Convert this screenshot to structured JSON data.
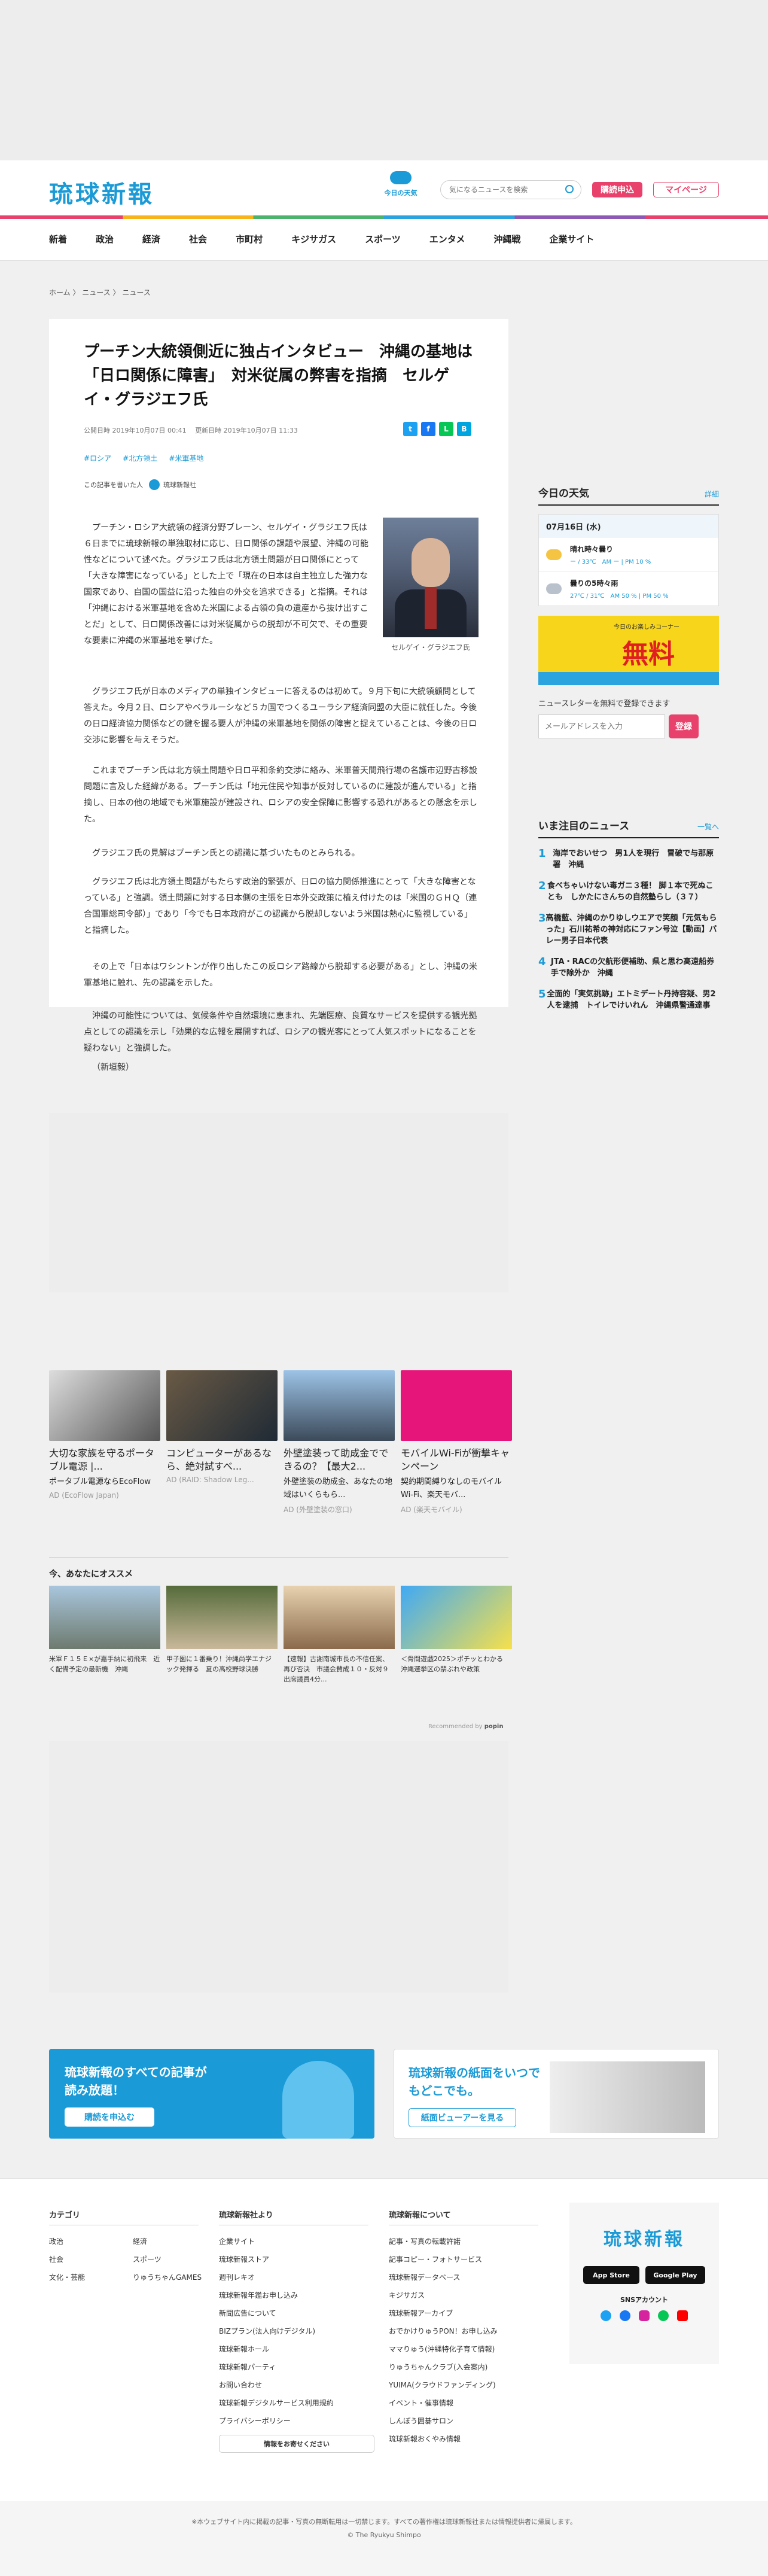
{
  "header": {
    "logo": "琉球新報",
    "weather_label": "今日の天気",
    "search_placeholder": "気になるニュースを検索",
    "subscribe": "購読申込",
    "mypage": "マイページ"
  },
  "nav": {
    "items": [
      "新着",
      "政治",
      "経済",
      "社会",
      "市町村",
      "キジサガス",
      "スポーツ",
      "エンタメ",
      "沖縄戦",
      "企業サイト"
    ]
  },
  "breadcrumb": [
    "ホーム",
    "ニュース",
    "ニュース"
  ],
  "article": {
    "title": "プーチン大統領側近に独占インタビュー　沖縄の基地は「日ロ関係に障害」　対米従属の弊害を指摘　セルゲイ・グラジエフ氏",
    "published": "公開日時 2019年10月07日 00:41",
    "updated": "更新日時 2019年10月07日 11:33",
    "tags": [
      "#ロシア",
      "#北方領土",
      "#米軍基地"
    ],
    "author_label": "この記事を書いた人",
    "author": "琉球新報社",
    "photo_caption": "セルゲイ・グラジエフ氏",
    "paragraphs": [
      "プーチン・ロシア大統領の経済分野ブレーン、セルゲイ・グラジエフ氏は６日までに琉球新報の単独取材に応じ、日ロ関係の課題や展望、沖縄の可能性などについて述べた。グラジエフ氏は北方領土問題が日ロ関係にとって「大きな障害になっている」とした上で「現在の日本は自主独立した強力な国家であり、自国の国益に沿った独自の外交を追求できる」と指摘。それは「沖縄における米軍基地を含めた米国による占領の負の遺産から抜け出すことだ」として、日ロ関係改善には対米従属からの脱却が不可欠で、その重要な要素に沖縄の米軍基地を挙げた。",
      "グラジエフ氏が日本のメディアの単独インタビューに答えるのは初めて。９月下旬に大統領顧問として答えた。今月２日、ロシアやベラルーシなど５カ国でつくるユーラシア経済同盟の大臣に就任した。今後の日ロ経済協力関係などの鍵を握る要人が沖縄の米軍基地を関係の障害と捉えていることは、今後の日ロ交渉に影響を与えそうだ。",
      "これまでプーチン氏は北方領土問題や日ロ平和条約交渉に絡み、米軍普天間飛行場の名護市辺野古移設問題に言及した経緯がある。プーチン氏は「地元住民や知事が反対しているのに建設が進んでいる」と指摘し、日本の他の地域でも米軍施設が建設され、ロシアの安全保障に影響する恐れがあるとの懸念を示した。",
      "グラジエフ氏の見解はプーチン氏との認識に基づいたものとみられる。",
      "グラジエフ氏は北方領土問題がもたらす政治的緊張が、日ロの協力関係推進にとって「大きな障害となっている」と強調。領土問題に対する日本側の主張を日本外交政策に植え付けたのは「米国のＧＨＱ（連合国軍総司令部）」であり「今でも日本政府がこの認識から脱却しないよう米国は熱心に監視している」と指摘した。",
      "その上で「日本はワシントンが作り出したこの反ロシア路線から脱却する必要がある」とし、沖縄の米軍基地に触れ、先の認識を示した。",
      "沖縄の可能性については、気候条件や自然環境に恵まれ、先端医療、良質なサービスを提供する観光拠点としての認識を示し「効果的な広報を展開すれば、ロシアの観光客にとって人気スポットになることを疑わない」と強調した。",
      "（新垣毅）"
    ]
  },
  "sidebar": {
    "weather_title": "今日の天気",
    "weather_detail": "詳細",
    "weather_date": "07月16日 (水)",
    "weather_today": "晴れ時々曇り",
    "weather_today_temp": "ー / 33℃　AM ー | PM 10 %",
    "weather_tomorrow": "曇りの5時々雨",
    "weather_tomorrow_temp": "27℃ / 31℃　AM 50 % | PM 50 %",
    "ad_text": "無料",
    "ad_sub": "今日のお楽しみコーナー",
    "newsletter": "ニュースレターを無料で登録できます",
    "newsletter_placeholder": "メールアドレスを入力",
    "newsletter_button": "登録",
    "ranking_title": "いま注目のニュース",
    "ranking_more": "一覧へ",
    "ranking": [
      {
        "n": "1",
        "t": "海岸でおいせつ　男1人を現行　冒破で与那原署　沖縄"
      },
      {
        "n": "2",
        "t": "食べちゃいけない毒ガニ３種！ 脚１本で死ぬことも　しかたにさんちの自然塾らし（３７）"
      },
      {
        "n": "3",
        "t": "高橋藍、沖縄のかりゆしウエアで笑顔「元気もらった」石川祐希の神対応にファン号泣【動画】バレー男子日本代表"
      },
      {
        "n": "4",
        "t": "JTA・RACの欠航形便補助、県と思わ高遠船券手で除外か　沖縄"
      },
      {
        "n": "5",
        "t": "全面的「実気挑跡」エトミデート丹持容疑、男2人を逮捕　トイレでけいれん　沖縄県警通達事"
      }
    ]
  },
  "ads": [
    {
      "t": "大切な家族を守るポータブル電源 |...",
      "s": "ポータブル電源ならEcoFlow",
      "a": "AD (EcoFlow Japan)"
    },
    {
      "t": "コンピューターがあるなら、絶対試すべ...",
      "s": "",
      "a": "AD (RAID: Shadow Leg..."
    },
    {
      "t": "外壁塗装って助成金でできるの？【最大2...",
      "s": "外壁塗装の助成金、あなたの地域はいくらもら...",
      "a": "AD (外壁塗装の窓口)"
    },
    {
      "t": "モバイルWi-Fiが衝撃キャンペーン",
      "s": "契約期間縛りなしのモバイルWi-Fi、楽天モバ...",
      "a": "AD (楽天モバイル)"
    }
  ],
  "recommend": {
    "title": "今、あなたにオススメ",
    "footer": "Recommended by",
    "items": [
      "米軍Ｆ１５Ｅ×が嘉手納に初飛来　近く配備予定の最新機　沖縄",
      "甲子園に１番乗り！沖縄尚学エナジック発揮る　夏の高校野球決勝",
      "【速報】古謝南城市長の不信任案、再び否決　市議会賛成１０・反対９　出席議員4分...",
      "＜骨間遊戯2025＞ポチッとわかる　沖縄選挙区の禁ぶれや政策"
    ]
  },
  "banners": {
    "left_title": "琉球新報のすべての記事が読み放題！",
    "left_button": "購読を申込む",
    "right_title": "琉球新報の紙面をいつでもどこでも。",
    "right_button": "紙面ビューアーを見る"
  },
  "footer": {
    "cat_title": "カテゴリ",
    "cats": [
      "政治",
      "経済",
      "社会",
      "スポーツ",
      "文化・芸能",
      "りゅうちゃんGAMES"
    ],
    "from_title": "琉球新報社より",
    "from": [
      "企業サイト",
      "琉球新報ストア",
      "週刊レキオ",
      "琉球新報年鑑お申し込み",
      "新聞広告について",
      "BIZプラン(法人向けデジタル)",
      "琉球新報ホール",
      "琉球新報パーティ",
      "お問い合わせ",
      "琉球新報デジタルサービス利用規約",
      "プライバシーポリシー"
    ],
    "about_title": "琉球新報について",
    "about": [
      "記事・写真の転載許諾",
      "記事コピー・フォトサービス",
      "琉球新報データベース",
      "キジサガス",
      "琉球新報アーカイブ",
      "おでかけりゅうPON！お申し込み",
      "ママりゅう(沖縄特化子育て情報)",
      "りゅうちゃんクラブ(入会案内)",
      "YUIMA(クラウドファンディング)",
      "イベント・催事情報",
      "しんぽう囲碁サロン",
      "琉球新報おくやみ情報"
    ],
    "info_button": "情報をお寄せください",
    "sns_label": "SNSアカウント",
    "app_store": "App Store",
    "google_play": "Google Play",
    "copyright1": "※本ウェブサイト内に掲載の記事・写真の無断転用は一切禁じます。すべての著作権は琉球新報社または情報提供者に帰属します。",
    "copyright2": "© The Ryukyu Shimpo"
  },
  "colors": {
    "brand": "#1a9ad6",
    "accent": "#e8416c"
  }
}
